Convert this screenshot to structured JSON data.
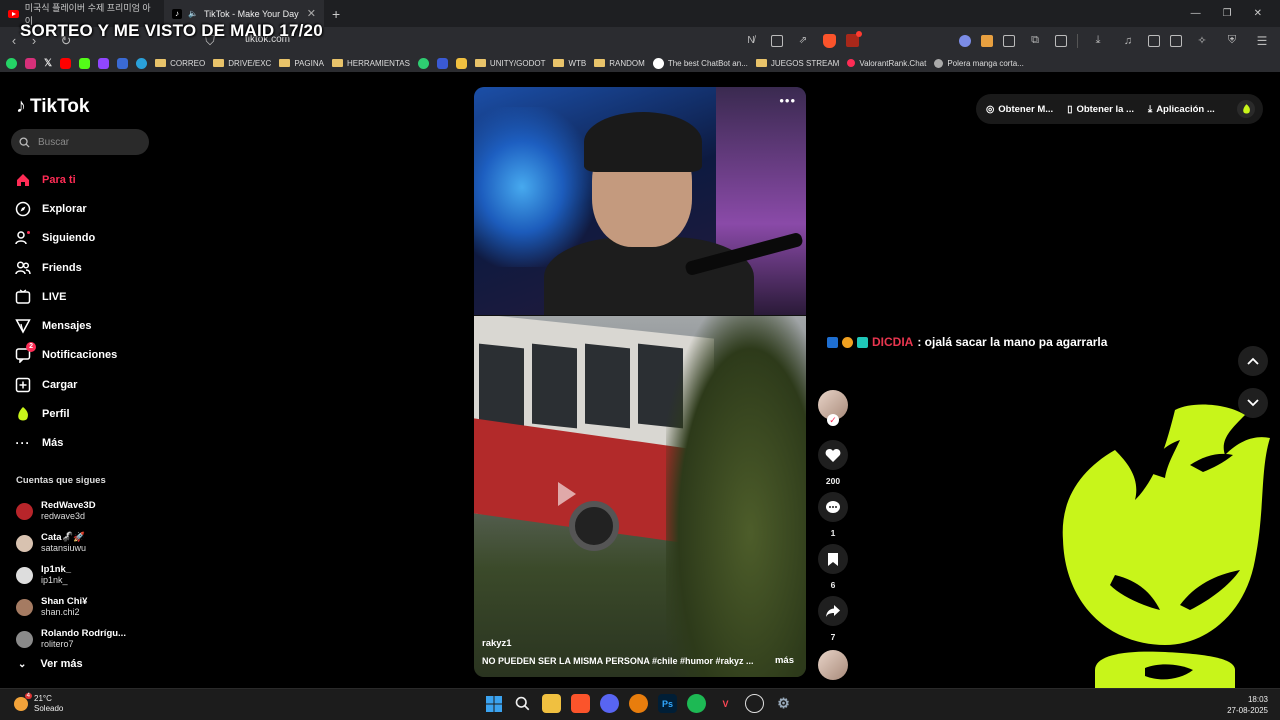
{
  "browser": {
    "tabs": [
      {
        "title": "미국식 플레이버 수제 프리미엄 아이"
      },
      {
        "title": "TikTok - Make Your Day"
      }
    ],
    "url": "tiktok.com",
    "overlay_title": "SORTEO Y ME VISTO DE MAID 17/20",
    "bookmarks": [
      "CORREO",
      "DRIVE/EXC",
      "PAGINA",
      "HERRAMIENTAS",
      "UNITY/GODOT",
      "WTB",
      "RANDOM",
      "The best ChatBot an...",
      "JUEGOS STREAM",
      "ValorantRank.Chat",
      "Polera manga corta..."
    ]
  },
  "sidebar": {
    "logo": "TikTok",
    "search_placeholder": "Buscar",
    "items": [
      {
        "label": "Para ti",
        "icon": "home-icon"
      },
      {
        "label": "Explorar",
        "icon": "compass-icon"
      },
      {
        "label": "Siguiendo",
        "icon": "following-icon"
      },
      {
        "label": "Friends",
        "icon": "friends-icon"
      },
      {
        "label": "LIVE",
        "icon": "live-icon"
      },
      {
        "label": "Mensajes",
        "icon": "send-icon"
      },
      {
        "label": "Notificaciones",
        "icon": "notification-icon",
        "badge": "2"
      },
      {
        "label": "Cargar",
        "icon": "upload-icon"
      },
      {
        "label": "Perfil",
        "icon": "profile-icon"
      },
      {
        "label": "Más",
        "icon": "more-icon"
      }
    ],
    "following_title": "Cuentas que sigues",
    "accounts": [
      {
        "name": "RedWave3D",
        "handle": "redwave3d"
      },
      {
        "name": "Cata🦨🚀",
        "handle": "satansiuwu"
      },
      {
        "name": "Ip1nk_",
        "handle": "ip1nk_"
      },
      {
        "name": "Shan Chi¥",
        "handle": "shan.chi2"
      },
      {
        "name": "Rolando Rodrígu...",
        "handle": "rolitero7"
      }
    ],
    "see_more": "Ver más"
  },
  "video": {
    "author": "rakyz1",
    "description": "NO PUEDEN SER LA MISMA PERSONA #chile #humor #rakyz ...",
    "more": "más",
    "likes": "200",
    "comments": "1",
    "saves": "6",
    "shares": "7"
  },
  "topright": {
    "item1": "Obtener M...",
    "item2": "Obtener la ...",
    "item3": "Aplicación ..."
  },
  "chat": {
    "user": "DICDIA",
    "message": ": ojalá sacar la mano pa agarrarla"
  },
  "taskbar": {
    "temp": "21°C",
    "condition": "Soleado",
    "weather_badge": "4",
    "time": "18:03",
    "date": "27-08-2025"
  },
  "colors": {
    "accent": "#fe2c55",
    "mascot": "#c8f51a",
    "chat_user": "#e8364f"
  }
}
